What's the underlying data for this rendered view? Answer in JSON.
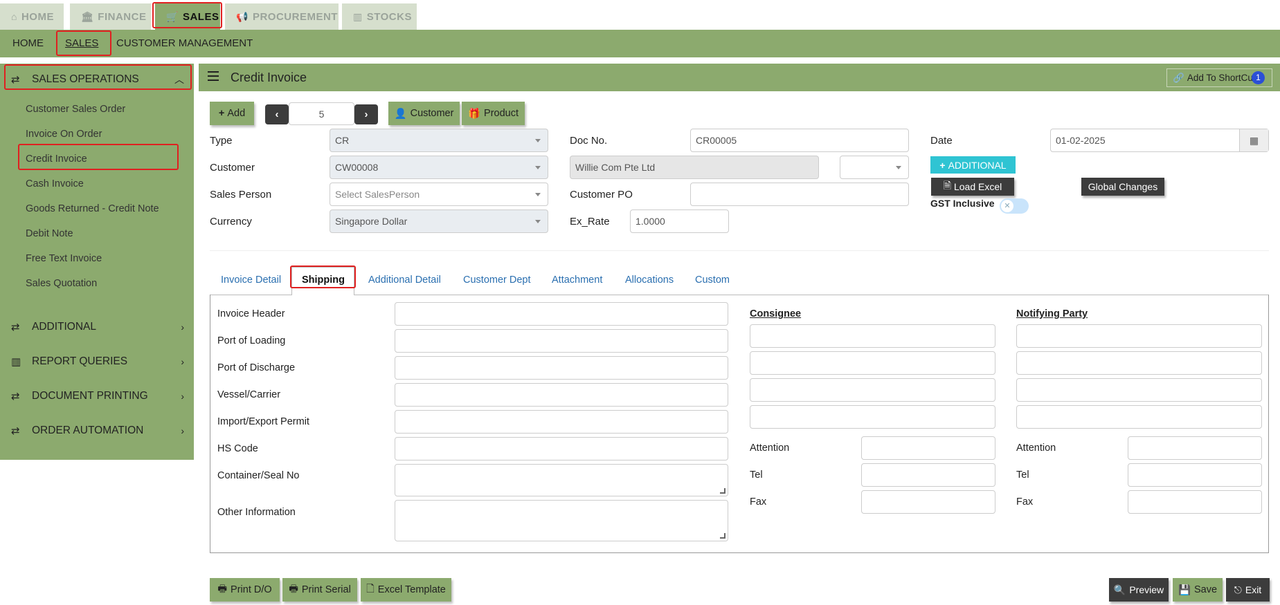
{
  "module_tabs": [
    {
      "label": "HOME",
      "icon": "home-icon"
    },
    {
      "label": "FINANCE",
      "icon": "bank-icon"
    },
    {
      "label": "SALES",
      "icon": "cart-icon"
    },
    {
      "label": "PROCUREMENT",
      "icon": "megaphone-icon"
    },
    {
      "label": "STOCKS",
      "icon": "bar-chart-icon"
    }
  ],
  "subnav": [
    "HOME",
    "SALES",
    "CUSTOMER MANAGEMENT"
  ],
  "sidebar": {
    "sections": [
      "SALES OPERATIONS",
      "ADDITIONAL",
      "REPORT QUERIES",
      "DOCUMENT PRINTING",
      "ORDER AUTOMATION"
    ],
    "items": [
      "Customer Sales Order",
      "Invoice On Order",
      "Credit Invoice",
      "Cash Invoice",
      "Goods Returned - Credit Note",
      "Debit Note",
      "Free Text Invoice",
      "Sales Quotation"
    ]
  },
  "header": {
    "title": "Credit Invoice",
    "shortcut": "Add To ShortCut",
    "badge": "1"
  },
  "toolbar": {
    "add": "Add",
    "record": "5",
    "customer": "Customer",
    "product": "Product"
  },
  "form": {
    "type_label": "Type",
    "type_value": "CR",
    "customer_label": "Customer",
    "customer_value": "CW00008",
    "sales_person_label": "Sales Person",
    "sales_person_placeholder": "Select SalesPerson",
    "currency_label": "Currency",
    "currency_value": "Singapore Dollar",
    "doc_no_label": "Doc No.",
    "doc_no_value": "CR00005",
    "customer_name": "Willie Com Pte Ltd",
    "customer_po_label": "Customer PO",
    "ex_rate_label": "Ex_Rate",
    "ex_rate_value": "1.0000",
    "date_label": "Date",
    "date_value": "01-02-2025",
    "additional_btn": "ADDITIONAL",
    "load_excel_btn": "Load Excel",
    "global_changes_btn": "Global Changes",
    "gst_label": "GST Inclusive"
  },
  "tabs": [
    "Invoice Detail",
    "Shipping",
    "Additional Detail",
    "Customer Dept",
    "Attachment",
    "Allocations",
    "Custom"
  ],
  "shipping": {
    "labels": [
      "Invoice Header",
      "Port of Loading",
      "Port of Discharge",
      "Vessel/Carrier",
      "Import/Export Permit",
      "HS Code",
      "Container/Seal No",
      "Other Information"
    ],
    "consignee": "Consignee",
    "notifying": "Notifying Party",
    "attention": "Attention",
    "tel": "Tel",
    "fax": "Fax"
  },
  "footer": {
    "print_do": "Print D/O",
    "print_serial": "Print Serial",
    "excel_template": "Excel Template",
    "preview": "Preview",
    "save": "Save",
    "exit": "Exit"
  },
  "colors": {
    "accent": "#8caa6e",
    "highlight": "#e02020",
    "info": "#1ec0d0"
  }
}
